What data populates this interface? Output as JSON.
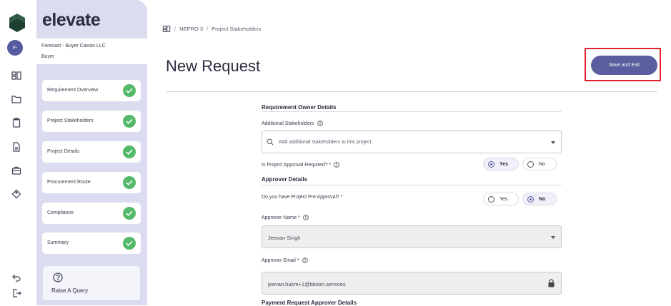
{
  "brand": {
    "name": "elevate"
  },
  "user": {
    "avatar_initials": "F-"
  },
  "company": {
    "name": "Forecast - Buyer Cassin LLC",
    "role": "Buyer"
  },
  "nav_rail": [
    {
      "icon": "dashboard-icon"
    },
    {
      "icon": "folder-icon"
    },
    {
      "icon": "clipboard-icon"
    },
    {
      "icon": "document-icon"
    },
    {
      "icon": "briefcase-icon"
    },
    {
      "icon": "tag-icon"
    },
    {
      "icon": "back-arrow-icon"
    },
    {
      "icon": "logout-icon"
    }
  ],
  "steps": [
    {
      "label": "Requirement Overview",
      "status": "complete"
    },
    {
      "label": "Project Stakeholders",
      "status": "complete"
    },
    {
      "label": "Project Details",
      "status": "complete"
    },
    {
      "label": "Procurement Route",
      "status": "complete"
    },
    {
      "label": "Compliance",
      "status": "complete"
    },
    {
      "label": "Summary",
      "status": "complete"
    }
  ],
  "query": {
    "label": "Raise A Query"
  },
  "breadcrumb": {
    "items": [
      "NEPRO 3",
      "Project Stakeholders"
    ]
  },
  "page": {
    "title": "New Request",
    "save_label": "Save and Exit"
  },
  "form": {
    "requirement_owner": {
      "title": "Requirement Owner Details",
      "stakeholders_label": "Additional Stakeholders",
      "stakeholders_placeholder": "Add additional stakeholders to this project",
      "approval_required_label": "Is Project Approval Required? *",
      "approval_required_yes": "Yes",
      "approval_required_no": "No",
      "approval_required_value": "Yes"
    },
    "approver": {
      "title": "Approver Details",
      "pre_approval_label": "Do you have Project Pre Approval? *",
      "pre_approval_yes": "Yes",
      "pre_approval_no": "No",
      "pre_approval_value": "No",
      "name_label": "Approver Name *",
      "name_value": "Jeevan Singh",
      "email_label": "Approver Email *",
      "email_value": "jeevan.hukm+1@bloom.services"
    },
    "next_section_title": "Payment Request Approver Details"
  },
  "colors": {
    "accent": "#5a5e9e",
    "success": "#55b96a",
    "sidebar": "#dcdcf0",
    "highlight": "#e0212e"
  }
}
